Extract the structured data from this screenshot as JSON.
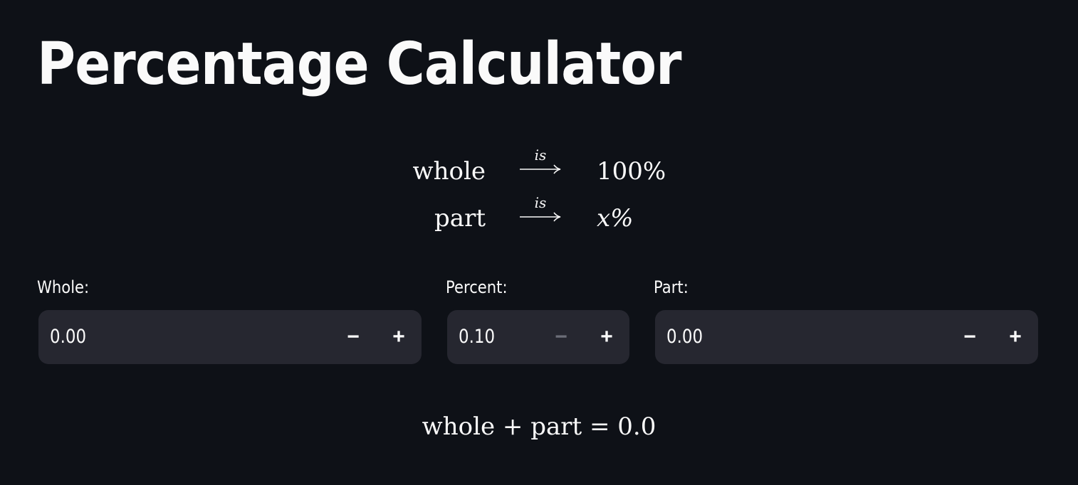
{
  "title": "Percentage Calculator",
  "formula": {
    "rows": [
      {
        "left": "whole",
        "arrow_label": "is",
        "right": "100%"
      },
      {
        "left": "part",
        "arrow_label": "is",
        "right": "x%"
      }
    ]
  },
  "inputs": [
    {
      "label": "Whole:",
      "value": "0.00",
      "minus": "−",
      "plus": "+",
      "minus_disabled": false
    },
    {
      "label": "Percent:",
      "value": "0.10",
      "minus": "−",
      "plus": "+",
      "minus_disabled": true
    },
    {
      "label": "Part:",
      "value": "0.00",
      "minus": "−",
      "plus": "+",
      "minus_disabled": false
    }
  ],
  "result": "whole + part = 0.0"
}
